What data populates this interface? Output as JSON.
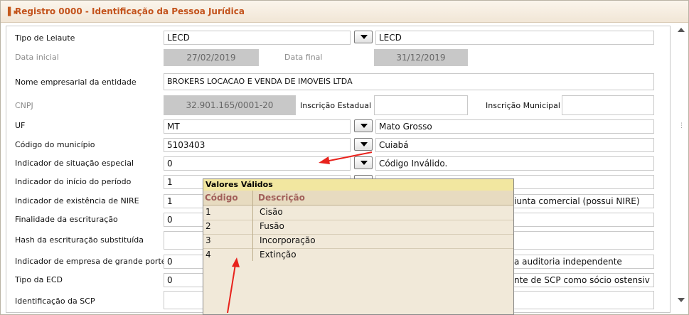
{
  "window": {
    "title": "Registro 0000 - Identificação da Pessoa Jurídica"
  },
  "form": {
    "tipo_leiaute": {
      "label": "Tipo de Leiaute",
      "code": "LECD",
      "desc": "LECD"
    },
    "data_inicial": {
      "label": "Data inicial",
      "value": "27/02/2019"
    },
    "data_final": {
      "label": "Data final",
      "value": "31/12/2019"
    },
    "nome_empresarial": {
      "label": "Nome empresarial da entidade",
      "value": "BROKERS LOCACAO E VENDA DE IMOVEIS LTDA"
    },
    "cnpj": {
      "label": "CNPJ",
      "value": "32.901.165/0001-20"
    },
    "inscricao_estadual": {
      "label": "Inscrição Estadual",
      "value": ""
    },
    "inscricao_municipal": {
      "label": "Inscrição Municipal",
      "value": ""
    },
    "uf": {
      "label": "UF",
      "code": "MT",
      "desc": "Mato Grosso"
    },
    "codigo_municipio": {
      "label": "Código do município",
      "code": "5103403",
      "desc": "Cuiabá"
    },
    "situacao_especial": {
      "label": "Indicador de situação especial",
      "code": "0",
      "desc": "Código Inválido."
    },
    "inicio_periodo": {
      "label": "Indicador do início do período",
      "code": "1",
      "desc": ""
    },
    "existencia_nire": {
      "label": "Indicador de existência de NIRE",
      "code": "1",
      "desc": "iunta comercial (possui NIRE)"
    },
    "finalidade": {
      "label": "Finalidade da escrituração",
      "code": "0"
    },
    "hash": {
      "label": "Hash da escrituração substituída",
      "value": ""
    },
    "grande_porte": {
      "label": "Indicador de empresa de grande porte",
      "code": "0",
      "desc": "a auditoria independente"
    },
    "tipo_ecd": {
      "label": "Tipo da ECD",
      "code": "0",
      "desc": "nte de SCP como sócio ostensiv"
    },
    "identificacao_scp": {
      "label": "Identificação da SCP",
      "value": ""
    }
  },
  "popup": {
    "title": "Valores Válidos",
    "col_code": "Código",
    "col_desc": "Descrição",
    "rows": [
      {
        "code": "1",
        "desc": "Cisão"
      },
      {
        "code": "2",
        "desc": "Fusão"
      },
      {
        "code": "3",
        "desc": "Incorporação"
      },
      {
        "code": "4",
        "desc": "Extinção"
      }
    ]
  },
  "colors": {
    "title_text": "#c3531c",
    "popup_header": "#f2e7a0",
    "arrow": "#e8221c"
  }
}
